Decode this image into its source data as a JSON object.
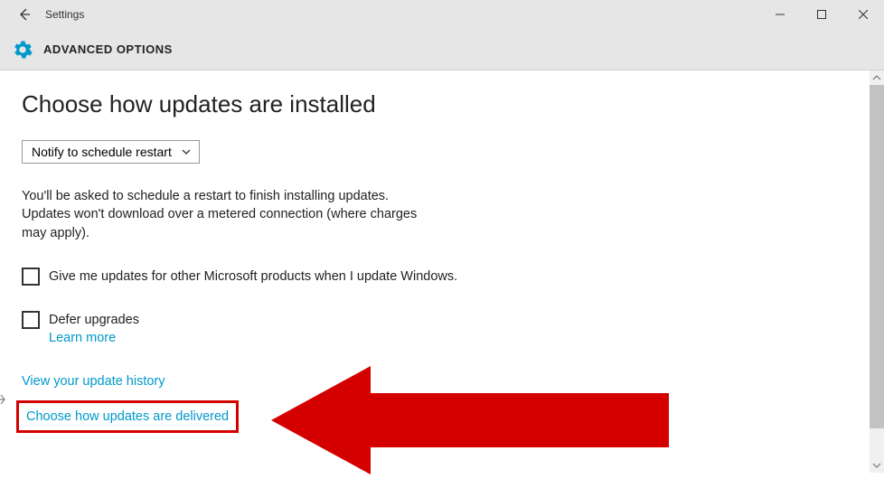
{
  "titlebar": {
    "app_name": "Settings"
  },
  "header": {
    "title": "ADVANCED OPTIONS"
  },
  "main": {
    "heading": "Choose how updates are installed",
    "dropdown_value": "Notify to schedule restart",
    "description": "You'll be asked to schedule a restart to finish installing updates. Updates won't download over a metered connection (where charges may apply).",
    "checkbox1_label": "Give me updates for other Microsoft products when I update Windows.",
    "checkbox2_label": "Defer upgrades",
    "learn_more": "Learn more",
    "link_history": "View your update history",
    "link_delivery": "Choose how updates are delivered"
  }
}
